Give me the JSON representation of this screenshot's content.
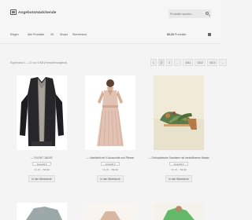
{
  "header": {
    "logo_text": "Angebotsmädchende",
    "search_placeholder": "Produkte suchen..."
  },
  "nav": {
    "items": [
      "Regen",
      "Alle Produkte",
      "29",
      "Shops",
      "Storebrand"
    ],
    "cart_amount": "80,00",
    "cart_label": "Produkte"
  },
  "results_text": "Ergebnisse 1 – 12 von 1908 (Herstellerangebot)",
  "pagination": [
    "1",
    "2",
    "3",
    "…",
    "4311",
    "4312",
    "4313",
    "→"
  ],
  "products": [
    {
      "title": "— FLIGHT JACKE",
      "select": "Auswahl ▾",
      "price_old": "99,95",
      "price_new": "59,99",
      "button": "In den Warenkorb"
    },
    {
      "title": "— Maxikleid mit V-Ausschnitt und Plissee",
      "select": "Auswahl ▾",
      "price_old": "99,95",
      "price_new": "59,99",
      "button": "In den Warenkorb"
    },
    {
      "title": "— Orthopädische Sandalen mit verstellbarem Absatz",
      "select": "Auswahl ▾",
      "price_old": "99,95",
      "price_new": "59,99",
      "button": "In den Warenkorb"
    }
  ]
}
